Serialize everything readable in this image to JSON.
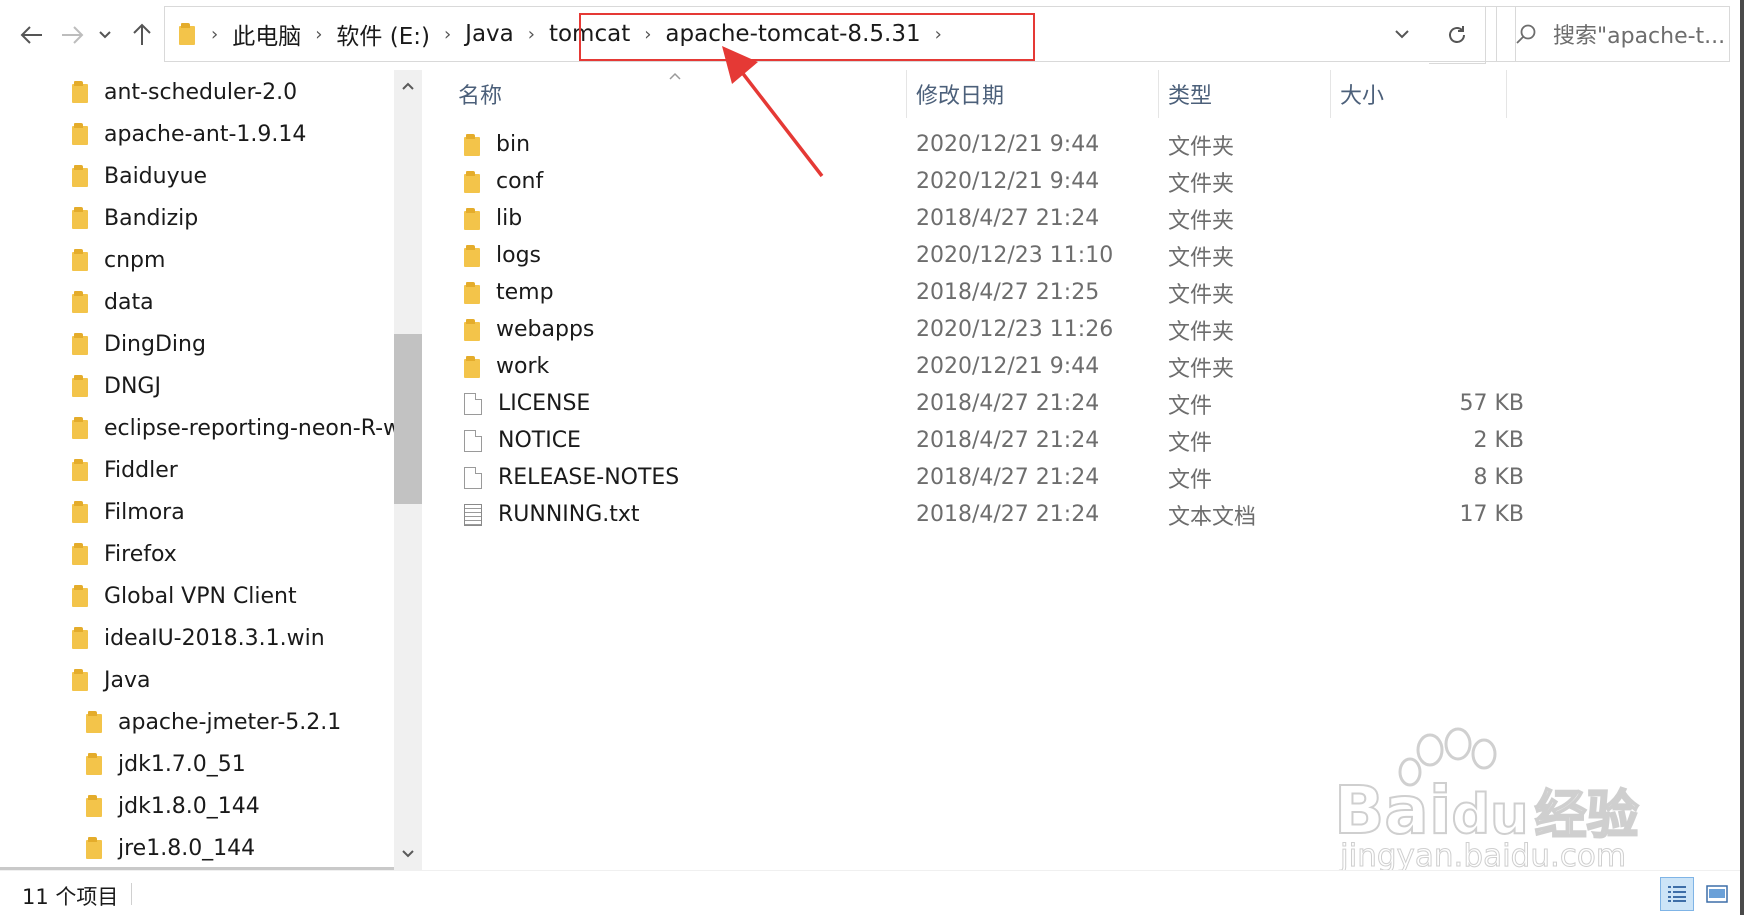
{
  "address_bar": {
    "crumbs": [
      "此电脑",
      "软件 (E:)",
      "Java",
      "tomcat",
      "apache-tomcat-8.5.31"
    ],
    "search_placeholder": "搜索\"apache-t..."
  },
  "nav_pane": {
    "items": [
      {
        "label": "ant-scheduler-2.0",
        "level": 0
      },
      {
        "label": "apache-ant-1.9.14",
        "level": 0
      },
      {
        "label": "Baiduyue",
        "level": 0
      },
      {
        "label": "Bandizip",
        "level": 0
      },
      {
        "label": "cnpm",
        "level": 0
      },
      {
        "label": "data",
        "level": 0
      },
      {
        "label": "DingDing",
        "level": 0
      },
      {
        "label": "DNGJ",
        "level": 0
      },
      {
        "label": "eclipse-reporting-neon-R-wi",
        "level": 0
      },
      {
        "label": "Fiddler",
        "level": 0
      },
      {
        "label": "Filmora",
        "level": 0
      },
      {
        "label": "Firefox",
        "level": 0
      },
      {
        "label": "Global VPN Client",
        "level": 0
      },
      {
        "label": "ideaIU-2018.3.1.win",
        "level": 0
      },
      {
        "label": "Java",
        "level": 0
      },
      {
        "label": "apache-jmeter-5.2.1",
        "level": 1
      },
      {
        "label": "jdk1.7.0_51",
        "level": 1
      },
      {
        "label": "jdk1.8.0_144",
        "level": 1
      },
      {
        "label": "jre1.8.0_144",
        "level": 1
      }
    ]
  },
  "file_list": {
    "columns": {
      "name": "名称",
      "date": "修改日期",
      "type": "类型",
      "size": "大小"
    },
    "rows": [
      {
        "icon": "folder-icon",
        "name": "bin",
        "date": "2020/12/21 9:44",
        "type": "文件夹",
        "size": ""
      },
      {
        "icon": "folder-icon",
        "name": "conf",
        "date": "2020/12/21 9:44",
        "type": "文件夹",
        "size": ""
      },
      {
        "icon": "folder-icon",
        "name": "lib",
        "date": "2018/4/27 21:24",
        "type": "文件夹",
        "size": ""
      },
      {
        "icon": "folder-icon",
        "name": "logs",
        "date": "2020/12/23 11:10",
        "type": "文件夹",
        "size": ""
      },
      {
        "icon": "folder-icon",
        "name": "temp",
        "date": "2018/4/27 21:25",
        "type": "文件夹",
        "size": ""
      },
      {
        "icon": "folder-icon",
        "name": "webapps",
        "date": "2020/12/23 11:26",
        "type": "文件夹",
        "size": ""
      },
      {
        "icon": "folder-icon",
        "name": "work",
        "date": "2020/12/21 9:44",
        "type": "文件夹",
        "size": ""
      },
      {
        "icon": "file-icon",
        "name": "LICENSE",
        "date": "2018/4/27 21:24",
        "type": "文件",
        "size": "57 KB"
      },
      {
        "icon": "file-icon",
        "name": "NOTICE",
        "date": "2018/4/27 21:24",
        "type": "文件",
        "size": "2 KB"
      },
      {
        "icon": "file-icon",
        "name": "RELEASE-NOTES",
        "date": "2018/4/27 21:24",
        "type": "文件",
        "size": "8 KB"
      },
      {
        "icon": "text-file-icon",
        "name": "RUNNING.txt",
        "date": "2018/4/27 21:24",
        "type": "文本文档",
        "size": "17 KB"
      }
    ]
  },
  "status_bar": {
    "item_count": "11 个项目"
  },
  "watermark": {
    "brand": "Bai",
    "brand2": "du",
    "brand_cn": "经验",
    "url": "jingyan.baidu.com"
  },
  "colors": {
    "highlight_border": "#e53935",
    "arrow": "#e53935",
    "header_text": "#4c607a",
    "folder": "#f3c44a"
  }
}
